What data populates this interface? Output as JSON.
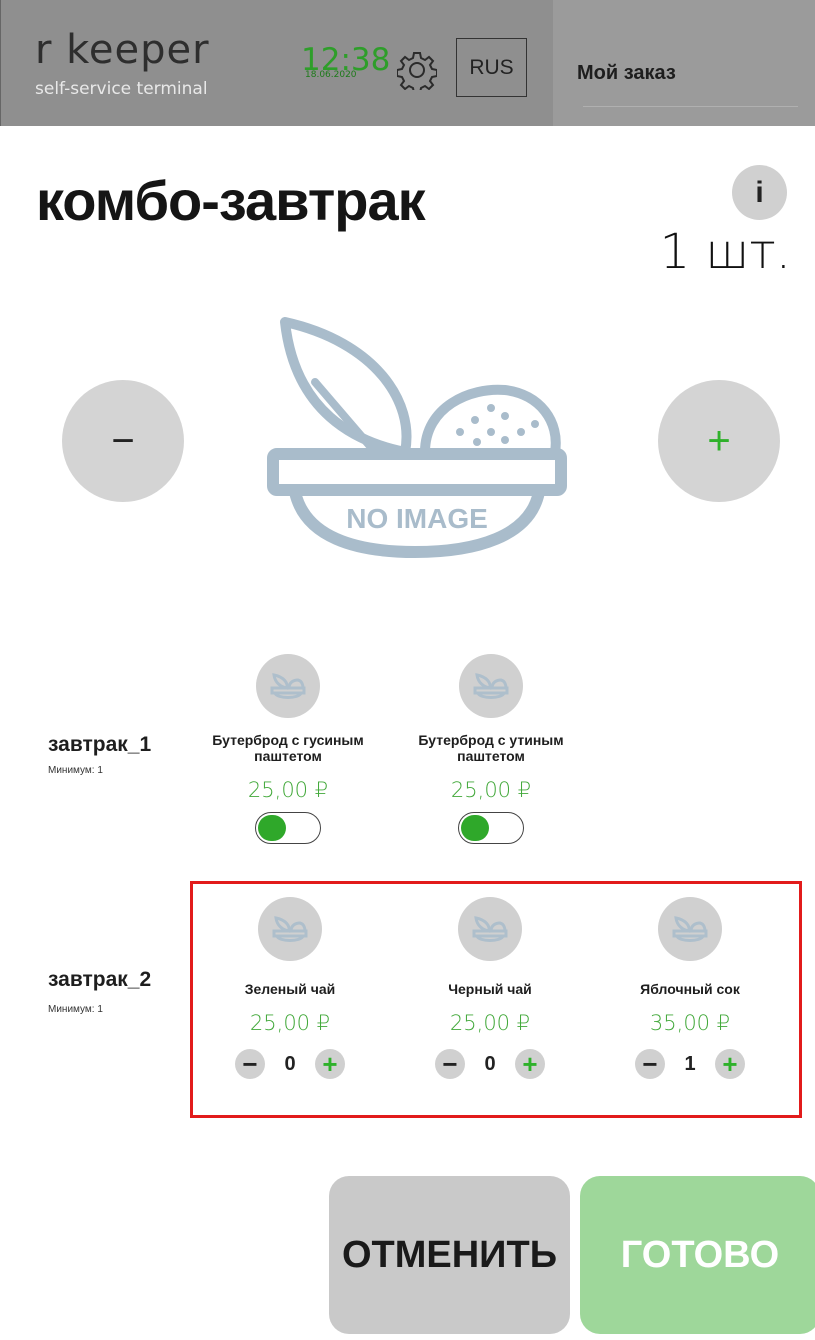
{
  "header": {
    "logo_name": "r keeper",
    "logo_sub": "self-service terminal",
    "time": "12:38",
    "date": "18.06.2020",
    "language": "RUS",
    "order_title": "Мой заказ"
  },
  "product": {
    "title": "комбо-завтрак",
    "info_label": "i",
    "quantity": "1 шт.",
    "minus_label": "−",
    "plus_label": "+",
    "no_image_label": "NO IMAGE"
  },
  "groups": [
    {
      "name": "завтрак_1",
      "min": "Минимум: 1",
      "items": [
        {
          "name": "Бутерброд с гусиным паштетом",
          "price": "25,00 ₽",
          "toggle_on": true
        },
        {
          "name": "Бутерброд с утиным паштетом",
          "price": "25,00 ₽",
          "toggle_on": true
        }
      ]
    },
    {
      "name": "завтрак_2",
      "min": "Минимум: 1",
      "items": [
        {
          "name": "Зеленый чай",
          "price": "25,00 ₽",
          "count": "0",
          "minus": "−",
          "plus": "+"
        },
        {
          "name": "Черный чай",
          "price": "25,00 ₽",
          "count": "0",
          "minus": "−",
          "plus": "+"
        },
        {
          "name": "Яблочный сок",
          "price": "35,00 ₽",
          "count": "1",
          "minus": "−",
          "plus": "+"
        }
      ]
    }
  ],
  "actions": {
    "cancel": "ОТМЕНИТЬ",
    "done": "ГОТОВО"
  },
  "colors": {
    "accent_green": "#43a93b",
    "highlight_red": "#e21b1b",
    "header_gray": "#8f8f8f"
  }
}
